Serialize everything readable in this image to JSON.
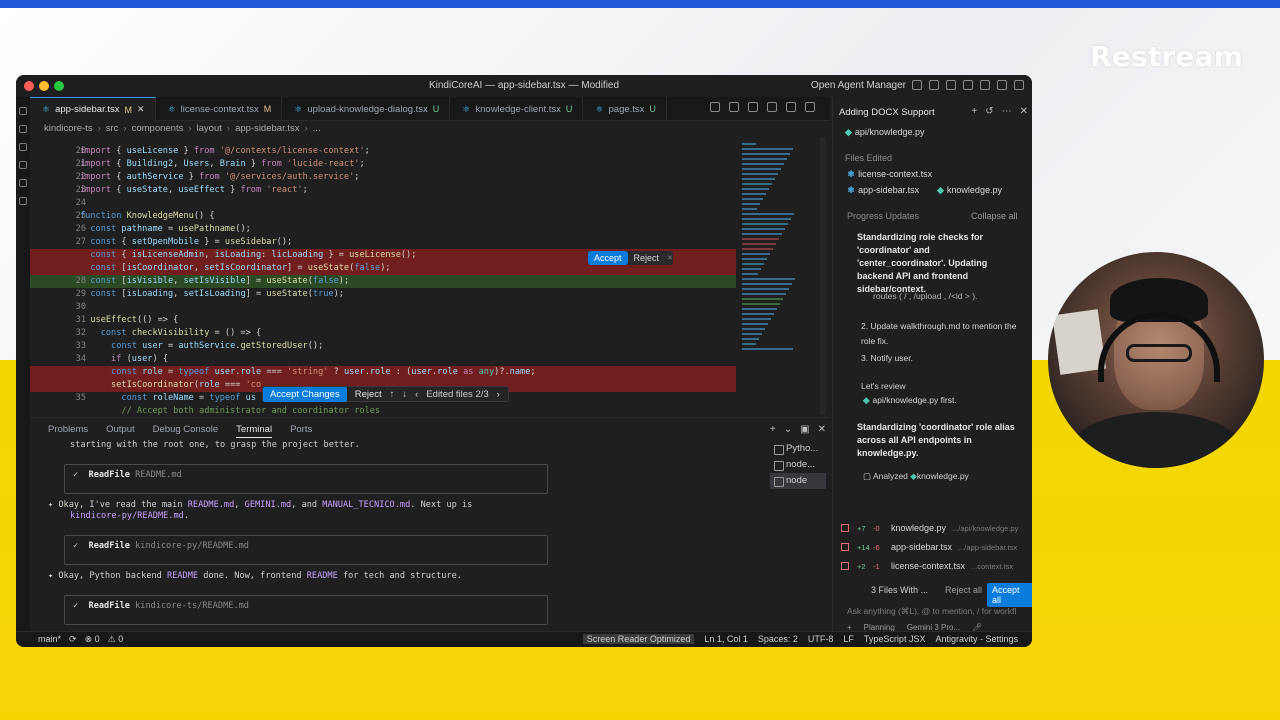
{
  "branding": {
    "name": "Restream"
  },
  "window": {
    "title": "KindiCoreAI — app-sidebar.tsx — Modified",
    "agent_manager_label": "Open Agent Manager"
  },
  "tabs": [
    {
      "name": "app-sidebar.tsx",
      "state": "M",
      "active": true
    },
    {
      "name": "license-context.tsx",
      "state": "M"
    },
    {
      "name": "upload-knowledge-dialog.tsx",
      "state": "U"
    },
    {
      "name": "knowledge-client.tsx",
      "state": "U"
    },
    {
      "name": "page.tsx",
      "state": "U"
    }
  ],
  "breadcrumb": [
    "kindicore-ts",
    "src",
    "components",
    "layout",
    "app-sidebar.tsx",
    "..."
  ],
  "editor": {
    "lines": [
      {
        "n": "20",
        "html": "<span class=\"kw\">import</span> { <span class=\"var\">useLicense</span> } <span class=\"kw\">from</span> <span class=\"str\">'@/contexts/license-context'</span>;"
      },
      {
        "n": "21",
        "html": "<span class=\"kw\">import</span> { <span class=\"var\">Building2</span>, <span class=\"var\">Users</span>, <span class=\"var\">Brain</span> } <span class=\"kw\">from</span> <span class=\"str\">'lucide-react'</span>;"
      },
      {
        "n": "22",
        "html": "<span class=\"kw\">import</span> { <span class=\"var\">authService</span> } <span class=\"kw\">from</span> <span class=\"str\">'@/services/auth.service'</span>;"
      },
      {
        "n": "23",
        "html": "<span class=\"kw\">import</span> { <span class=\"var\">useState</span>, <span class=\"var\">useEffect</span> } <span class=\"kw\">from</span> <span class=\"str\">'react'</span>;"
      },
      {
        "n": "24",
        "html": ""
      },
      {
        "n": "25",
        "html": "<span class=\"kw2\">function</span> <span class=\"fn\">KnowledgeMenu</span>() {"
      },
      {
        "n": "26",
        "html": "  <span class=\"kw2\">const</span> <span class=\"var\">pathname</span> = <span class=\"fn\">usePathname</span>();"
      },
      {
        "n": "27",
        "html": "  <span class=\"kw2\">const</span> { <span class=\"var\">setOpenMobile</span> } = <span class=\"fn\">useSidebar</span>();"
      },
      {
        "n": "",
        "cls": "del",
        "html": "  <span class=\"kw2\">const</span> { <span class=\"var\">isLicenseAdmin</span>, <span class=\"var\">isLoading</span>: <span class=\"var\">licLoading</span> } = <span class=\"fn\">useLicense</span>();"
      },
      {
        "n": "",
        "cls": "del",
        "html": "  <span class=\"kw2\">const</span> [<span class=\"var\">isCoordinator</span>, <span class=\"var\">setIsCoordinator</span>] = <span class=\"fn\">useState</span>(<span class=\"kw2\">false</span>);"
      },
      {
        "n": "28",
        "cls": "add",
        "html": "  <span class=\"kw2\">const</span> [<span class=\"var\">isVisible</span>, <span class=\"var\">setIsVisible</span>] = <span class=\"fn\">useState</span>(<span class=\"kw2\">false</span>);"
      },
      {
        "n": "29",
        "html": "  <span class=\"kw2\">const</span> [<span class=\"var\">isLoading</span>, <span class=\"var\">setIsLoading</span>] = <span class=\"fn\">useState</span>(<span class=\"kw2\">true</span>);"
      },
      {
        "n": "30",
        "html": ""
      },
      {
        "n": "31",
        "html": "  <span class=\"fn\">useEffect</span>(() => {"
      },
      {
        "n": "32",
        "html": "    <span class=\"kw2\">const</span> <span class=\"fn\">checkVisibility</span> = () => {"
      },
      {
        "n": "33",
        "html": "      <span class=\"kw2\">const</span> <span class=\"var\">user</span> = <span class=\"var\">authService</span>.<span class=\"fn\">getStoredUser</span>();"
      },
      {
        "n": "34",
        "html": "      <span class=\"kw\">if</span> (<span class=\"var\">user</span>) {"
      },
      {
        "n": "",
        "cls": "del",
        "html": "      <span class=\"kw2\">const</span> <span class=\"var\">role</span> = <span class=\"kw2\">typeof</span> <span class=\"var\">user</span>.<span class=\"var\">role</span> === <span class=\"str\">'string'</span> ? <span class=\"var\">user</span>.<span class=\"var\">role</span> : (<span class=\"var\">user</span>.<span class=\"var\">role</span> <span class=\"kw\">as</span> <span class=\"ty\">any</span>)?.<span class=\"var\">name</span>;"
      },
      {
        "n": "",
        "cls": "del",
        "html": "      <span class=\"fn\">setIsCoordinator</span>(<span class=\"var\">role</span> === <span class=\"str\">'co</span>"
      },
      {
        "n": "35",
        "html": "        <span class=\"kw2\">const</span> <span class=\"var\">roleName</span> = <span class=\"kw2\">typeof</span> <span class=\"var\">us</span>"
      },
      {
        "n": "",
        "html": "        <span style=\"color:#6a9955\">// Accept both administrator and coordinator roles</span>"
      }
    ],
    "inline_accept": {
      "accept": "Accept",
      "reject": "Reject"
    },
    "review": {
      "accept": "Accept Changes",
      "reject": "Reject",
      "edited": "Edited files 2/3"
    }
  },
  "panel": {
    "tabs": [
      "Problems",
      "Output",
      "Debug Console",
      "Terminal",
      "Ports"
    ],
    "active_tab": "Terminal",
    "terminal": {
      "line1": "starting with the root one, to grasp the project better.",
      "box1_cmd": "ReadFile",
      "box1_arg": "README.md",
      "msg2_a": "Okay, I've read the main ",
      "msg2_b": "README.md",
      "msg2_c": ", ",
      "msg2_d": "GEMINI.md",
      "msg2_e": ", and ",
      "msg2_f": "MANUAL_TECNICO.md",
      "msg2_g": ". Next up is",
      "msg2_h": "kindicore-py/README.md",
      "msg2_i": ".",
      "box2_cmd": "ReadFile",
      "box2_arg": "kindicore-py/README.md",
      "msg3_a": "Okay, Python backend ",
      "msg3_b": "README",
      "msg3_c": " done. Now, frontend ",
      "msg3_d": "README",
      "msg3_e": " for tech and structure.",
      "box3_cmd": "ReadFile",
      "box3_arg": "kindicore-ts/README.md"
    },
    "terminal_list": [
      "Pytho...",
      "node...",
      "node"
    ]
  },
  "status": {
    "branch": "main*",
    "errors": "0",
    "warnings": "0",
    "screen_reader": "Screen Reader Optimized",
    "position": "Ln 1, Col 1",
    "spaces": "Spaces: 2",
    "encoding": "UTF-8",
    "eol": "LF",
    "language": "TypeScript JSX",
    "settings": "Antigravity - Settings"
  },
  "agent": {
    "title": "Adding DOCX Support",
    "file_top": "api/knowledge.py",
    "files_edited_label": "Files Edited",
    "files_edited": [
      "license-context.tsx",
      "app-sidebar.tsx",
      "knowledge.py"
    ],
    "progress_label": "Progress Updates",
    "collapse_label": "Collapse all",
    "progress1": "Standardizing role checks for 'coordinator' and 'center_coordinator'. Updating backend API and frontend sidebar/context.",
    "steps": [
      "routes ( / , /upload , /<id > ).",
      "2. Update walkthrough.md to mention the role fix.",
      "3. Notify user."
    ],
    "review_text_a": "Let's review",
    "review_file": "api/knowledge.py",
    "review_text_b": "first.",
    "progress2": "Standardizing 'coordinator' role alias across all API endpoints in knowledge.py.",
    "analyzed": "Analyzed",
    "analyzed_file": "knowledge.py",
    "changes": [
      {
        "plus": "+7",
        "minus": "-0",
        "file": "knowledge.py",
        "path": ".../api/knowledge.py"
      },
      {
        "plus": "+14",
        "minus": "-6",
        "file": "app-sidebar.tsx",
        "path": ".../app-sidebar.tsx"
      },
      {
        "plus": "+2",
        "minus": "-1",
        "file": "license-context.tsx",
        "path": "...context.tsx"
      }
    ],
    "files_with": "3 Files With ...",
    "reject_all": "Reject all",
    "accept_all": "Accept all",
    "ask_placeholder": "Ask anything (⌘L), @ to mention, / for workfl",
    "mode": "Planning",
    "model": "Gemini 3 Pro..."
  },
  "colors": {
    "accent": "#0a7cdb",
    "editor_bg": "#1f1f1f",
    "brand_yellow": "#f6d400",
    "brand_blue": "#1f57d6"
  }
}
